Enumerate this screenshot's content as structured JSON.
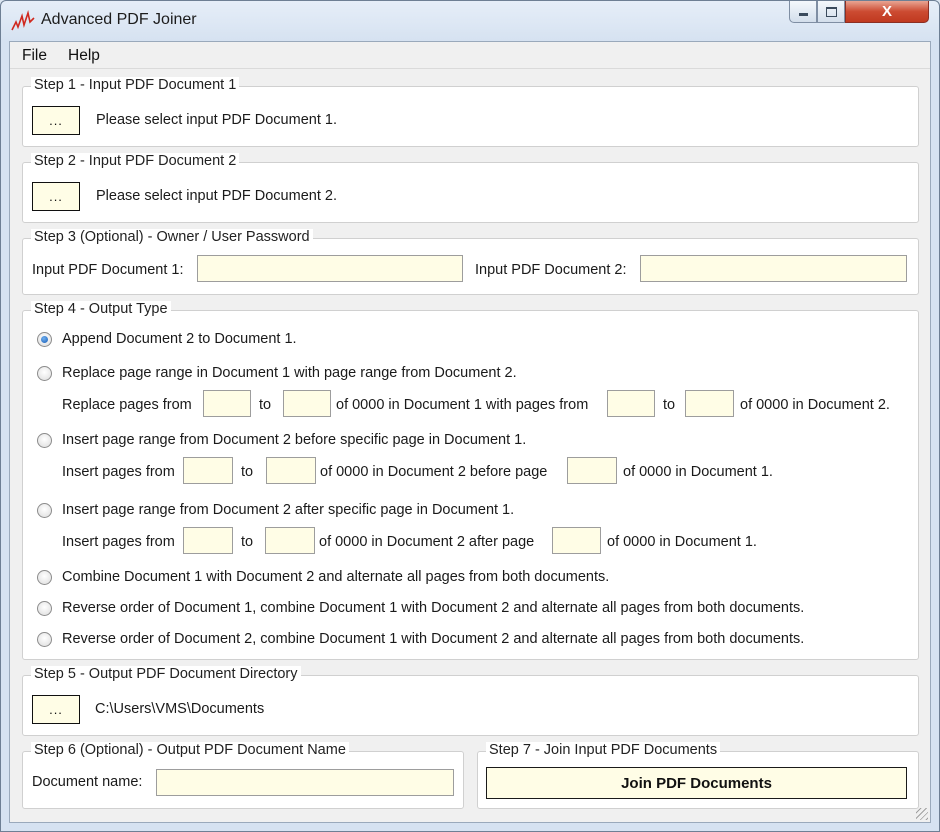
{
  "window": {
    "title": "Advanced PDF Joiner",
    "close_glyph": "X"
  },
  "menu": {
    "file": "File",
    "help": "Help"
  },
  "browse_label": "...",
  "step1": {
    "legend": "Step 1 - Input PDF Document 1",
    "status": "Please select input PDF Document 1."
  },
  "step2": {
    "legend": "Step 2 - Input PDF Document 2",
    "status": "Please select input PDF Document 2."
  },
  "step3": {
    "legend": "Step 3 (Optional) - Owner / User Password",
    "doc1_label": "Input PDF Document 1:",
    "doc2_label": "Input PDF Document 2:"
  },
  "step4": {
    "legend": "Step 4 - Output Type",
    "selected_option": "append",
    "opt_append": "Append Document 2 to Document 1.",
    "opt_replace": "Replace page range in Document 1 with page range from Document 2.",
    "replace_from": "Replace pages from",
    "to": "to",
    "replace_mid": "of 0000 in Document 1 with pages from",
    "replace_end": "of 0000  in Document 2.",
    "opt_insert_before": "Insert page range from Document 2 before specific page in Document 1.",
    "insert_from": "Insert pages from",
    "before_mid": "of 0000 in Document 2 before page",
    "of_0000": "of  0000  in Document 1.",
    "opt_insert_after": "Insert page range from Document 2 after specific page in Document 1.",
    "after_mid": "of 0000 in Document 2 after page",
    "opt_combine": "Combine Document 1 with Document 2 and alternate all pages from both documents.",
    "opt_reverse1": "Reverse order of Document 1, combine Document 1 with Document 2 and alternate all pages from both documents.",
    "opt_reverse2": "Reverse order of Document 2, combine Document 1 with Document 2 and alternate all pages from both documents."
  },
  "step5": {
    "legend": "Step 5 - Output PDF Document Directory",
    "path": "C:\\Users\\VMS\\Documents"
  },
  "step6": {
    "legend": "Step 6 (Optional) - Output PDF Document Name",
    "name_label": "Document name:"
  },
  "step7": {
    "legend": "Step 7 - Join Input PDF Documents",
    "button": "Join PDF Documents"
  },
  "colors": {
    "field_bg": "#fffde6",
    "selected_radio": "#1a5db6",
    "close_button": "#c0391f"
  }
}
